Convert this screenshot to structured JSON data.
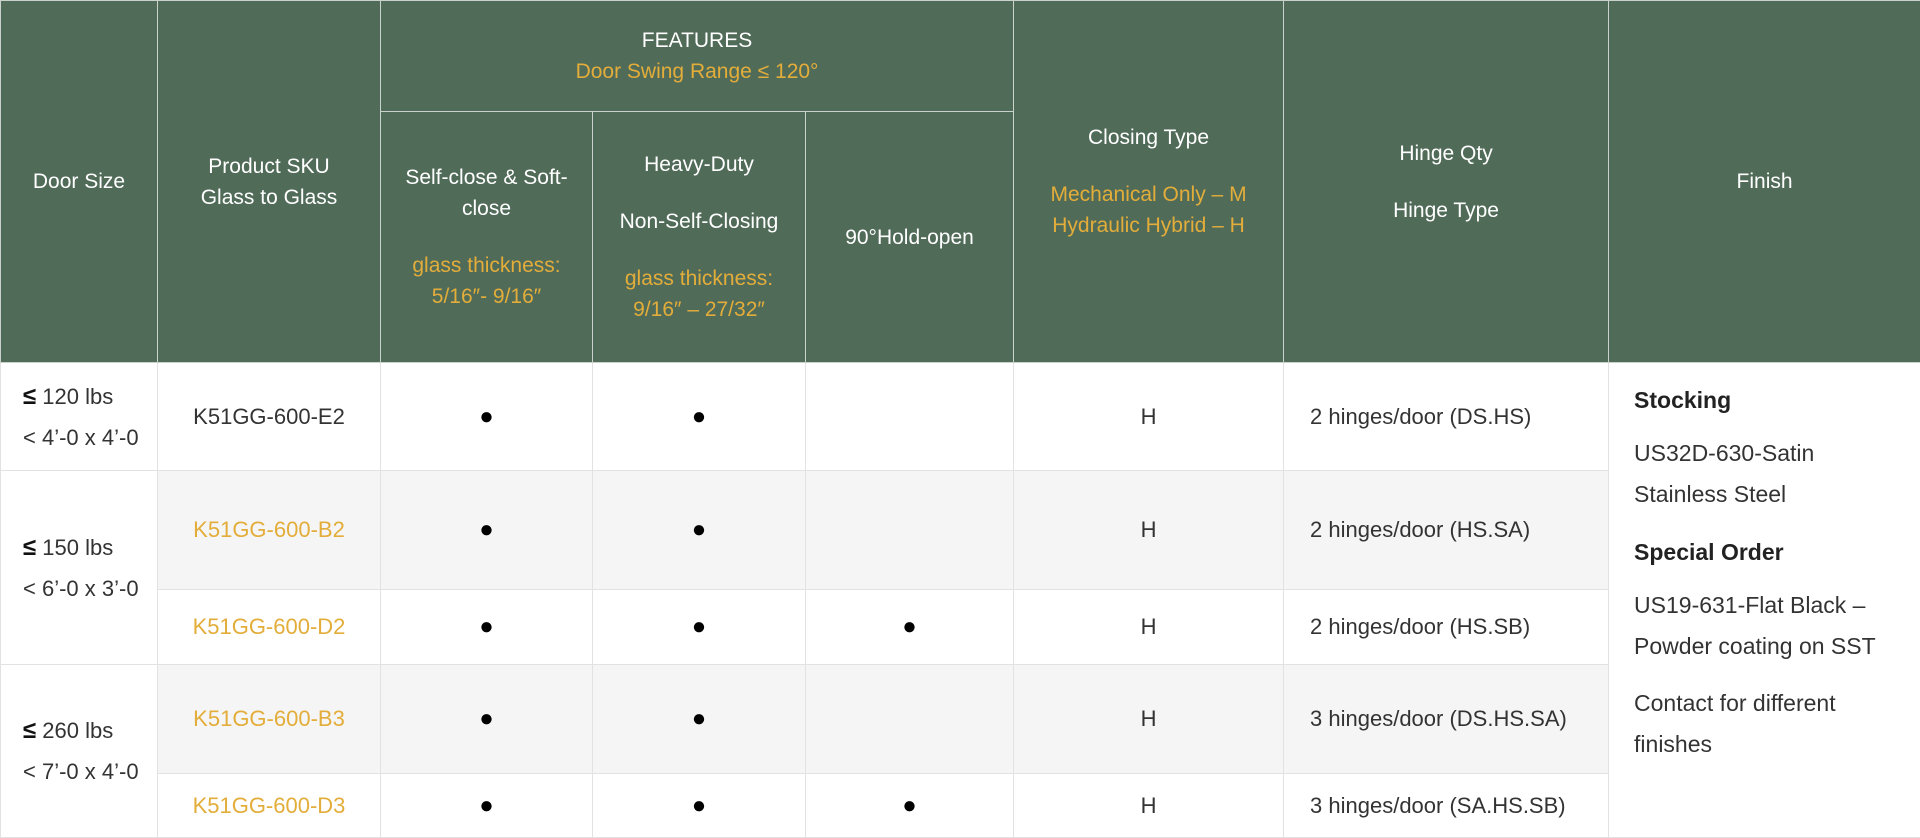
{
  "header": {
    "door_size": "Door Size",
    "product_sku": "Product SKU",
    "product_sku_sub": "Glass to Glass",
    "features": "FEATURES",
    "features_range": "Door Swing Range ≤ 120°",
    "selfclose_title": "Self-close & Soft-close",
    "selfclose_glass": "glass thickness: 5/16″- 9/16″",
    "heavy_title": "Heavy-Duty",
    "heavy_sub": "Non-Self-Closing",
    "heavy_glass": "glass thickness: 9/16″ – 27/32″",
    "holdopen": "90°Hold-open",
    "closing_type": "Closing Type",
    "closing_m": "Mechanical Only – M",
    "closing_h": "Hydraulic Hybrid – H",
    "hinge_qty": "Hinge Qty",
    "hinge_type": "Hinge Type",
    "finish": "Finish"
  },
  "sizes": [
    {
      "weight": "120 lbs",
      "dims": "< 4’-0 x 4’-0"
    },
    {
      "weight": "150 lbs",
      "dims": "< 6’-0 x 3’-0"
    },
    {
      "weight": "260 lbs",
      "dims": "< 7’-0 x 4’-0"
    }
  ],
  "le_symbol": "≤",
  "dot": "●",
  "rows": [
    {
      "sku": "K51GG-600-E2",
      "selfclose": "●",
      "heavy": "●",
      "holdopen": "",
      "closing": "H",
      "hinge": "2 hinges/door (DS.HS)"
    },
    {
      "sku": "K51GG-600-B2",
      "selfclose": "●",
      "heavy": "●",
      "holdopen": "",
      "closing": "H",
      "hinge": "2 hinges/door (HS.SA)"
    },
    {
      "sku": "K51GG-600-D2",
      "selfclose": "●",
      "heavy": "●",
      "holdopen": "●",
      "closing": "H",
      "hinge": "2 hinges/door (HS.SB)"
    },
    {
      "sku": "K51GG-600-B3",
      "selfclose": "●",
      "heavy": "●",
      "holdopen": "",
      "closing": "H",
      "hinge": "3 hinges/door (DS.HS.SA)"
    },
    {
      "sku": "K51GG-600-D3",
      "selfclose": "●",
      "heavy": "●",
      "holdopen": "●",
      "closing": "H",
      "hinge": "3 hinges/door (SA.HS.SB)"
    }
  ],
  "finish": {
    "stocking_title": "Stocking",
    "stocking_text": "US32D-630-Satin Stainless Steel",
    "special_title": "Special Order",
    "special_text": "US19-631-Flat Black – Powder coating on SST",
    "contact_text": "Contact for different finishes"
  },
  "colors": {
    "header_bg": "#516b59",
    "accent_gold": "#e3ad3a",
    "row_shade": "#f5f5f5"
  }
}
